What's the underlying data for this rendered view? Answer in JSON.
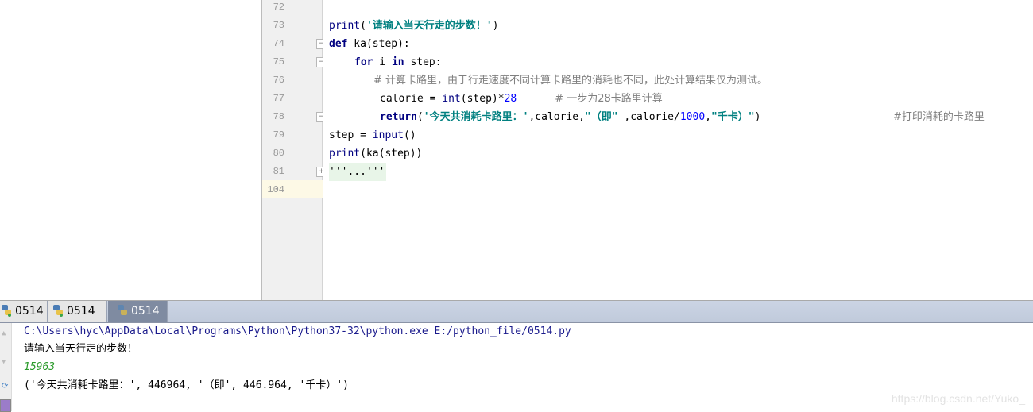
{
  "editor": {
    "line_numbers": [
      "72",
      "73",
      "74",
      "75",
      "76",
      "77",
      "78",
      "79",
      "80",
      "81",
      "104"
    ],
    "lines": {
      "l73": {
        "fn": "print",
        "p1": "(",
        "str": "'请输入当天行走的步数！'",
        "p2": ")"
      },
      "l74": {
        "kw": "def",
        "rest": " ka(step):"
      },
      "l75": {
        "kw1": "for",
        "mid": " i ",
        "kw2": "in",
        "rest": " step:"
      },
      "l76": {
        "comment": "# 计算卡路里，由于行走速度不同计算卡路里的消耗也不同，此处计算结果仅为测试。"
      },
      "l77": {
        "a": "calorie = ",
        "fn": "int",
        "b": "(step)*",
        "num": "28",
        "comment": "# 一步为28卡路里计算"
      },
      "l78": {
        "kw": "return",
        "p1": "(",
        "s1": "'今天共消耗卡路里：'",
        "a": ",calorie,",
        "s2": "\"（即\"",
        "b": " ,calorie/",
        "num": "1000",
        "c": ",",
        "s3": "\"千卡）\"",
        "p2": ")",
        "comment": "#打印消耗的卡路里"
      },
      "l79": {
        "a": "step = ",
        "fn": "input",
        "b": "()"
      },
      "l80": {
        "fn1": "print",
        "a": "(ka(step))"
      },
      "l81": {
        "folded": "'''...'''"
      }
    }
  },
  "run_tabs": [
    {
      "label": "0514",
      "state": "inactive"
    },
    {
      "label": "0514",
      "state": "inactive"
    },
    {
      "label": "0514",
      "state": "active"
    }
  ],
  "console": {
    "command": "C:\\Users\\hyc\\AppData\\Local\\Programs\\Python\\Python37-32\\python.exe E:/python_file/0514.py",
    "prompt": "请输入当天行走的步数！",
    "user_input": "15963",
    "result": "('今天共消耗卡路里：', 446964, '（即', 446.964, '千卡）')"
  },
  "watermark": "https://blog.csdn.net/Yuko_"
}
